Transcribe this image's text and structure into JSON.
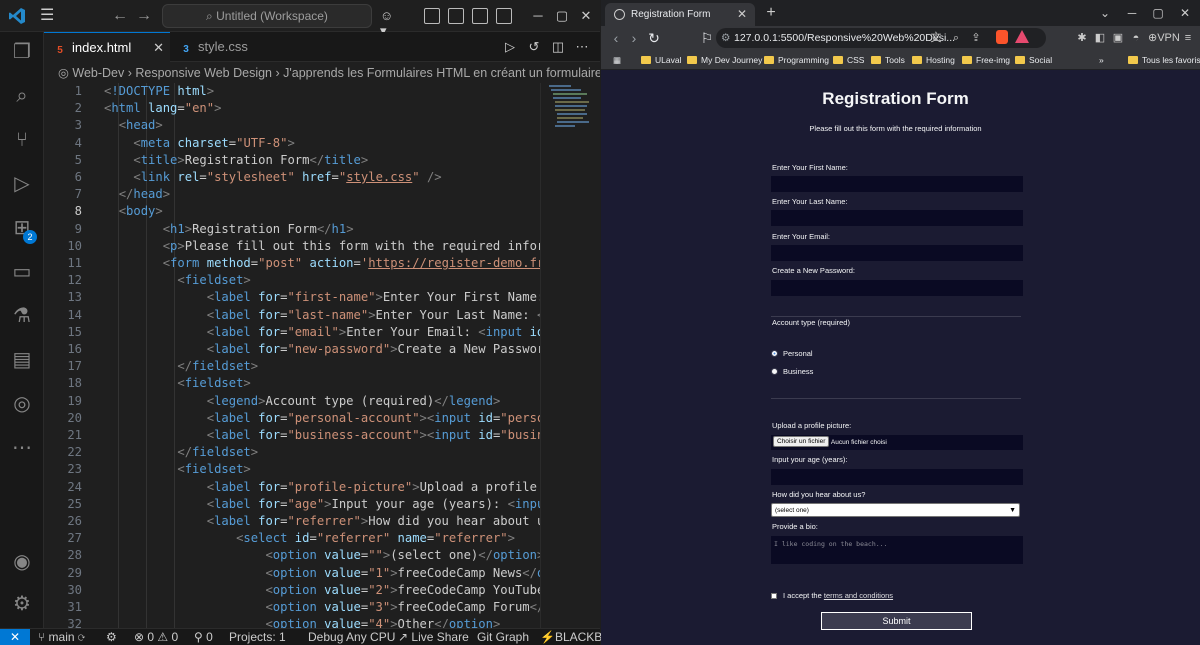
{
  "vscode": {
    "search_text": "Untitled (Workspace)",
    "tabs": [
      {
        "label": "index.html",
        "type": "html"
      },
      {
        "label": "style.css",
        "type": "css"
      }
    ],
    "breadcrumb": "Web-Dev  ›  Responsive Web Design  ›  J'apprends les Formulaires HTML en créant un formulaire d'ins",
    "activity_badge": "2",
    "status": {
      "branch": "main",
      "errors": "0",
      "warnings": "0",
      "ports": "0",
      "projects": "Projects: 1",
      "debug": "Debug Any CPU",
      "live_share": "Live Share",
      "git_graph": "Git Graph",
      "blackbox": "BLACKBO"
    }
  },
  "browser": {
    "tab_title": "Registration Form",
    "url": "127.0.0.1:5500/Responsive%20Web%20Desi...",
    "vpn": "VPN",
    "bookmarks": [
      "ULaval",
      "My Dev Journey",
      "Programming",
      "CSS",
      "Tools",
      "Hosting",
      "Free-img",
      "Social"
    ],
    "all_bookmarks": "Tous les favoris"
  },
  "form": {
    "title": "Registration Form",
    "subtitle": "Please fill out this form with the required information",
    "first_name": "Enter Your First Name:",
    "last_name": "Enter Your Last Name:",
    "email": "Enter Your Email:",
    "password": "Create a New Password:",
    "legend": "Account type (required)",
    "personal": "Personal",
    "business": "Business",
    "profile": "Upload a profile picture:",
    "file_button": "Choisir un fichier",
    "file_status": "Aucun fichier choisi",
    "age": "Input your age (years):",
    "referrer": "How did you hear about us?",
    "referrer_selected": "(select one)",
    "bio": "Provide a bio:",
    "bio_placeholder": "I like coding on the beach...",
    "terms_prefix": "I accept the ",
    "terms_link": "terms and conditions",
    "submit": "Submit"
  }
}
